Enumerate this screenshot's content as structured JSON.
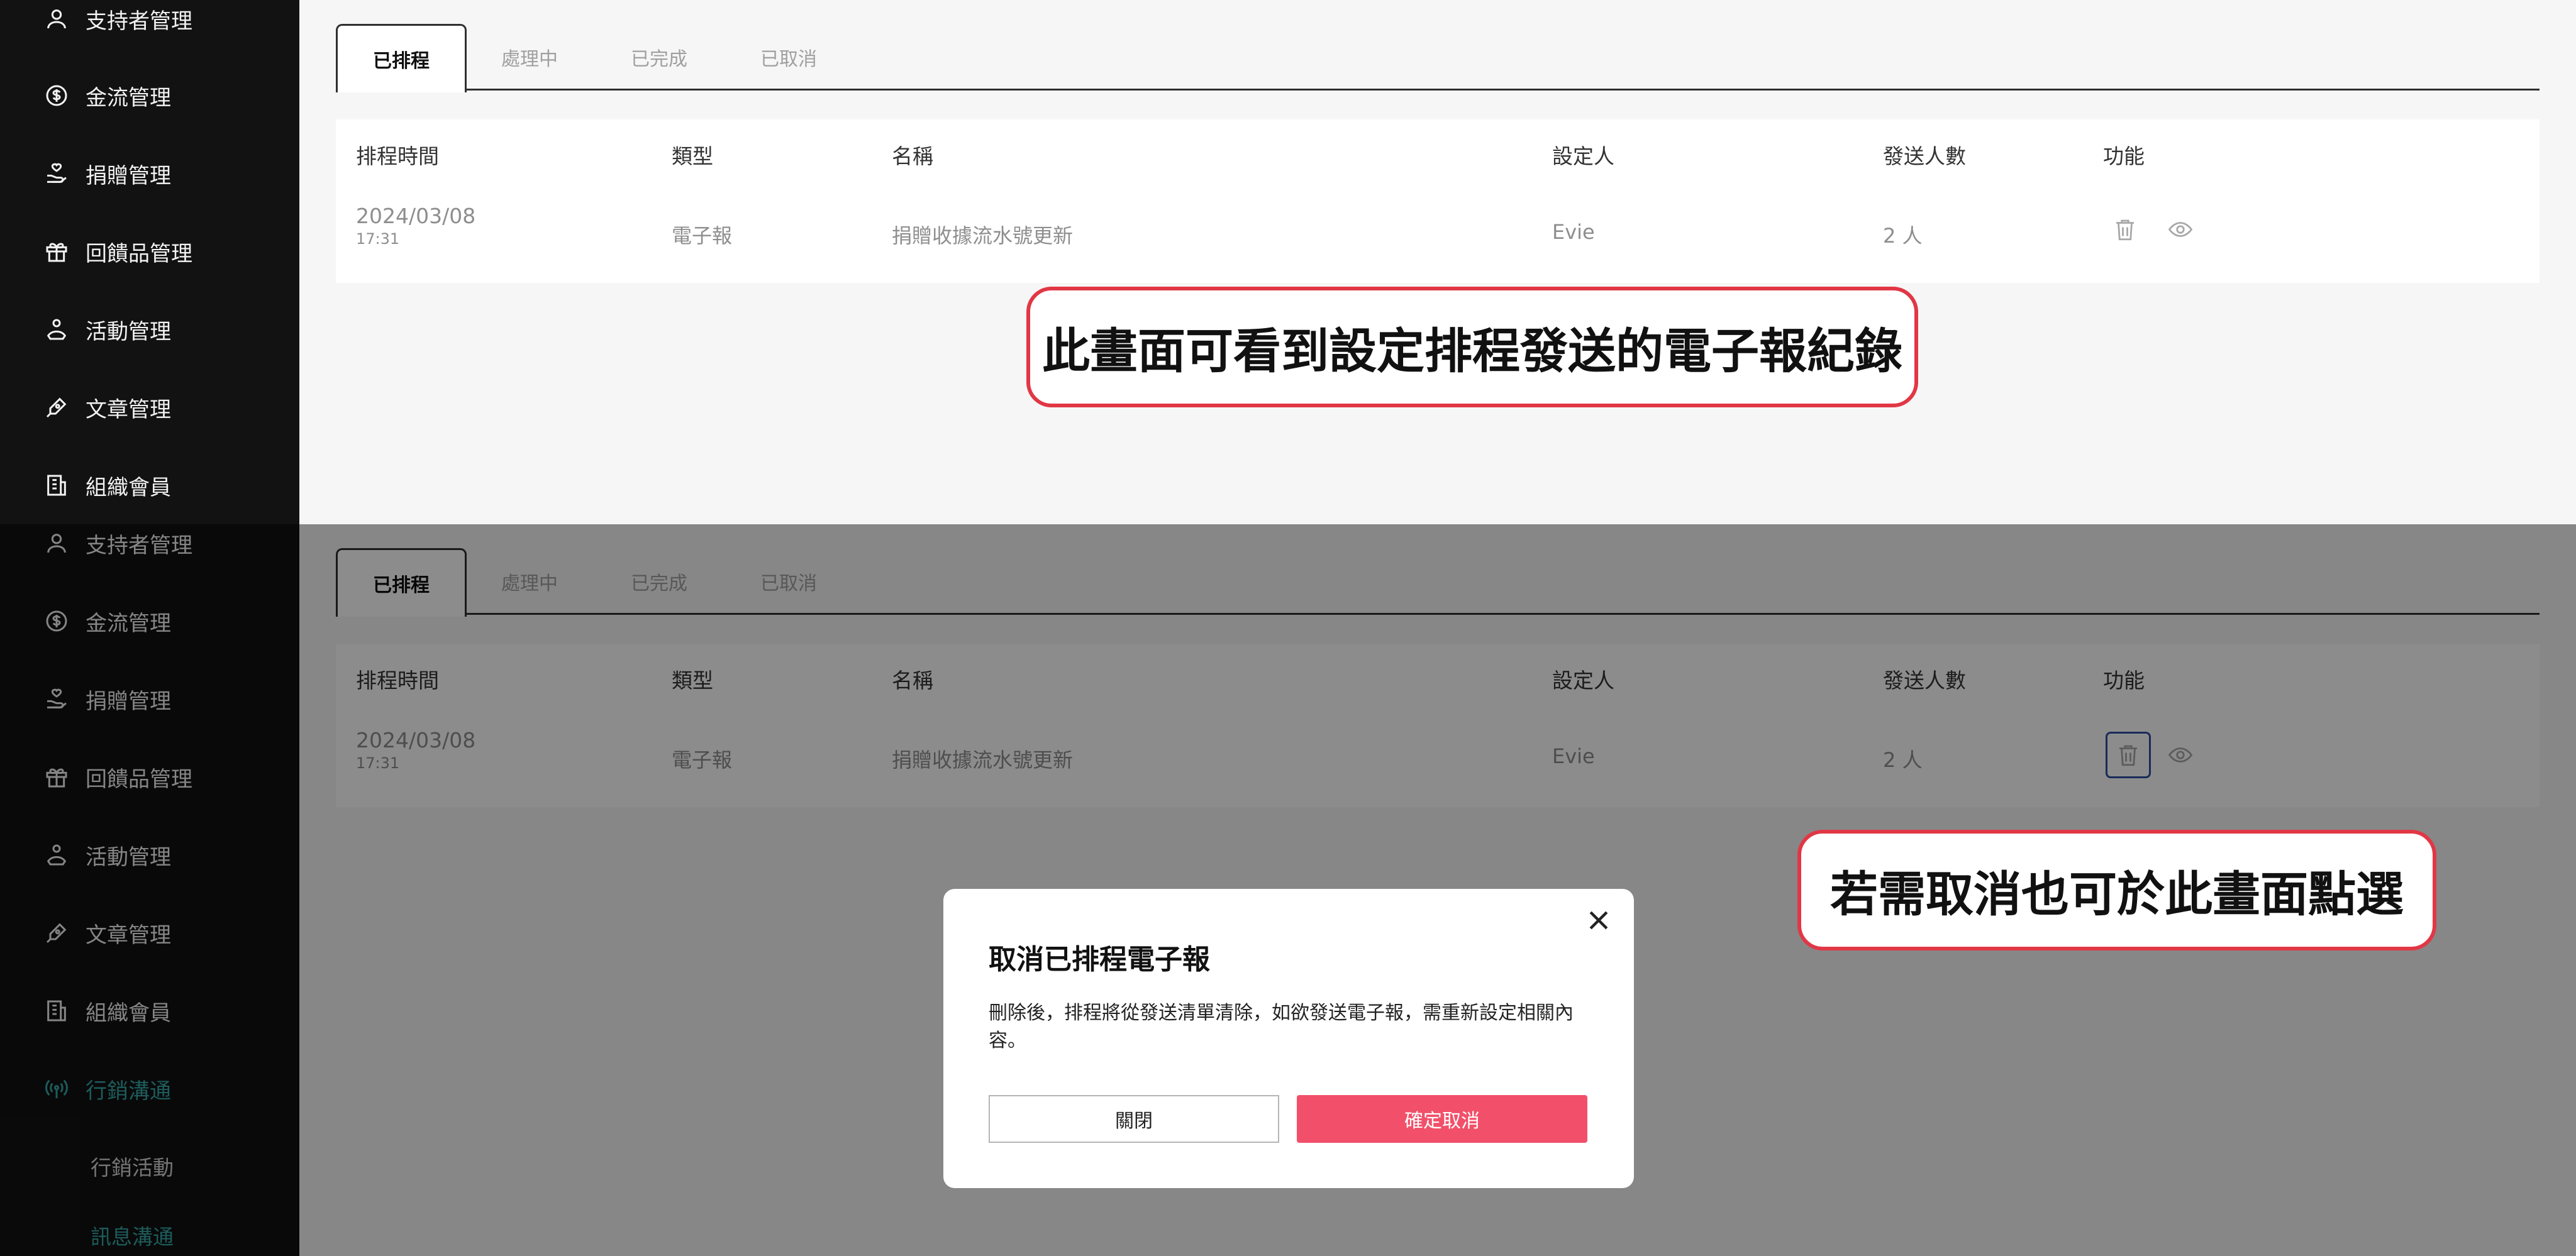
{
  "sidebar": {
    "top_items": [
      {
        "label": "支持者管理",
        "icon": "person-icon"
      },
      {
        "label": "金流管理",
        "icon": "dollar-coin-icon"
      },
      {
        "label": "捐贈管理",
        "icon": "hand-donation-icon"
      },
      {
        "label": "回饋品管理",
        "icon": "gift-icon"
      },
      {
        "label": "活動管理",
        "icon": "flag-hand-icon"
      },
      {
        "label": "文章管理",
        "icon": "pen-icon"
      },
      {
        "label": "組織會員",
        "icon": "building-icon"
      }
    ],
    "bottom_items": [
      {
        "label": "支持者管理",
        "icon": "person-icon"
      },
      {
        "label": "金流管理",
        "icon": "dollar-coin-icon"
      },
      {
        "label": "捐贈管理",
        "icon": "hand-donation-icon"
      },
      {
        "label": "回饋品管理",
        "icon": "gift-icon"
      },
      {
        "label": "活動管理",
        "icon": "flag-hand-icon"
      },
      {
        "label": "文章管理",
        "icon": "pen-icon"
      },
      {
        "label": "組織會員",
        "icon": "building-icon"
      },
      {
        "label": "行銷溝通",
        "icon": "broadcast-icon",
        "active": true
      }
    ],
    "sub_items": [
      {
        "label": "行銷活動"
      },
      {
        "label": "訊息溝通",
        "active": true
      }
    ]
  },
  "tabs": [
    {
      "label": "已排程",
      "active": true
    },
    {
      "label": "處理中"
    },
    {
      "label": "已完成"
    },
    {
      "label": "已取消"
    }
  ],
  "table": {
    "headers": [
      "排程時間",
      "類型",
      "名稱",
      "設定人",
      "發送人數",
      "功能"
    ],
    "row": {
      "date": "2024/03/08",
      "time": "17:31",
      "type": "電子報",
      "name": "捐贈收據流水號更新",
      "setter": "Evie",
      "count": "2 人"
    }
  },
  "callouts": {
    "top": "此畫面可看到設定排程發送的電子報紀錄",
    "bottom": "若需取消也可於此畫面點選"
  },
  "modal": {
    "title": "取消已排程電子報",
    "body": "刪除後，排程將從發送清單清除，如欲發送電子報，需重新設定相關內容。",
    "close_label": "關閉",
    "confirm_label": "確定取消"
  },
  "colors": {
    "accent": "#35a6a6",
    "confirm": "#f2506a",
    "callout_border": "#e13745",
    "sidebar_bg": "#121212"
  }
}
